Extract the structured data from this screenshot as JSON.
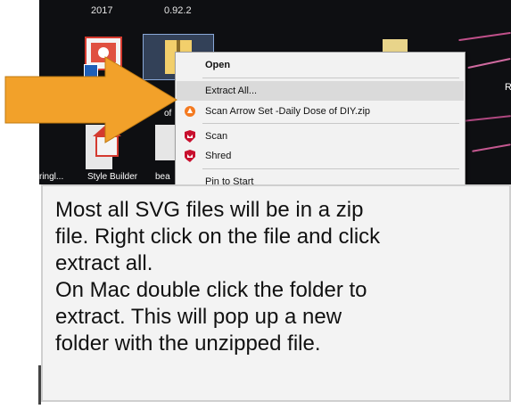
{
  "desktop": {
    "top_labels": [
      "2017",
      "0.92.2"
    ],
    "icons": [
      {
        "label": "ringl..."
      },
      {
        "label": "Style Builder"
      },
      {
        "label": "bea"
      },
      {
        "label": "of"
      }
    ],
    "right_edge_text": "R"
  },
  "context_menu": {
    "items": [
      {
        "label": "Open",
        "bold": true
      },
      {
        "label": "Extract All...",
        "highlighted": true
      },
      {
        "label": "Scan Arrow Set -Daily Dose of DIY.zip",
        "icon": "avast-icon"
      },
      {
        "label": "Scan",
        "icon": "mcafee-shield-icon"
      },
      {
        "label": "Shred",
        "icon": "mcafee-shield-icon"
      },
      {
        "label": "Pin to Start"
      }
    ]
  },
  "arrow": {
    "color": "#f2a12a",
    "icon": "arrow-right-icon"
  },
  "callout": {
    "lines": [
      "Most all SVG files will be in a zip",
      "file.  Right click on the file and click",
      "extract all.",
      "On Mac double click the folder to",
      "extract. This will pop up a new",
      "folder with the unzipped file."
    ]
  }
}
